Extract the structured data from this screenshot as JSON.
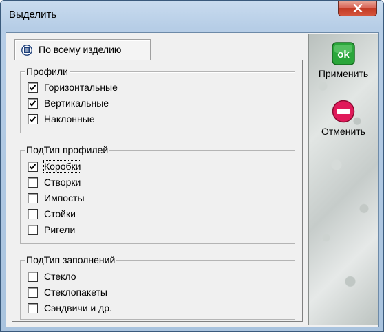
{
  "window": {
    "title": "Выделить"
  },
  "tab": {
    "label": "По всему изделию"
  },
  "groups": [
    {
      "title": "Профили",
      "items": [
        {
          "label": "Горизонтальные",
          "checked": true
        },
        {
          "label": "Вертикальные",
          "checked": true
        },
        {
          "label": "Наклонные",
          "checked": true
        }
      ]
    },
    {
      "title": "ПодТип профилей",
      "items": [
        {
          "label": "Коробки",
          "checked": true
        },
        {
          "label": "Створки",
          "checked": false
        },
        {
          "label": "Импосты",
          "checked": false
        },
        {
          "label": "Стойки",
          "checked": false
        },
        {
          "label": "Ригели",
          "checked": false
        }
      ]
    },
    {
      "title": "ПодТип заполнений",
      "items": [
        {
          "label": "Стекло",
          "checked": false
        },
        {
          "label": "Стеклопакеты",
          "checked": false
        },
        {
          "label": "Сэндвичи и др.",
          "checked": false
        }
      ]
    }
  ],
  "actions": {
    "apply": {
      "label": "Применить",
      "icon_text": "ok",
      "icon": "ok-icon",
      "color": "#2aa63a"
    },
    "cancel": {
      "label": "Отменить",
      "icon": "stop-icon",
      "color": "#e01a5a"
    }
  },
  "colors": {
    "close_button": "#c33b25",
    "title_bar": "#b6cde6",
    "panel": "#f0f0f0"
  }
}
